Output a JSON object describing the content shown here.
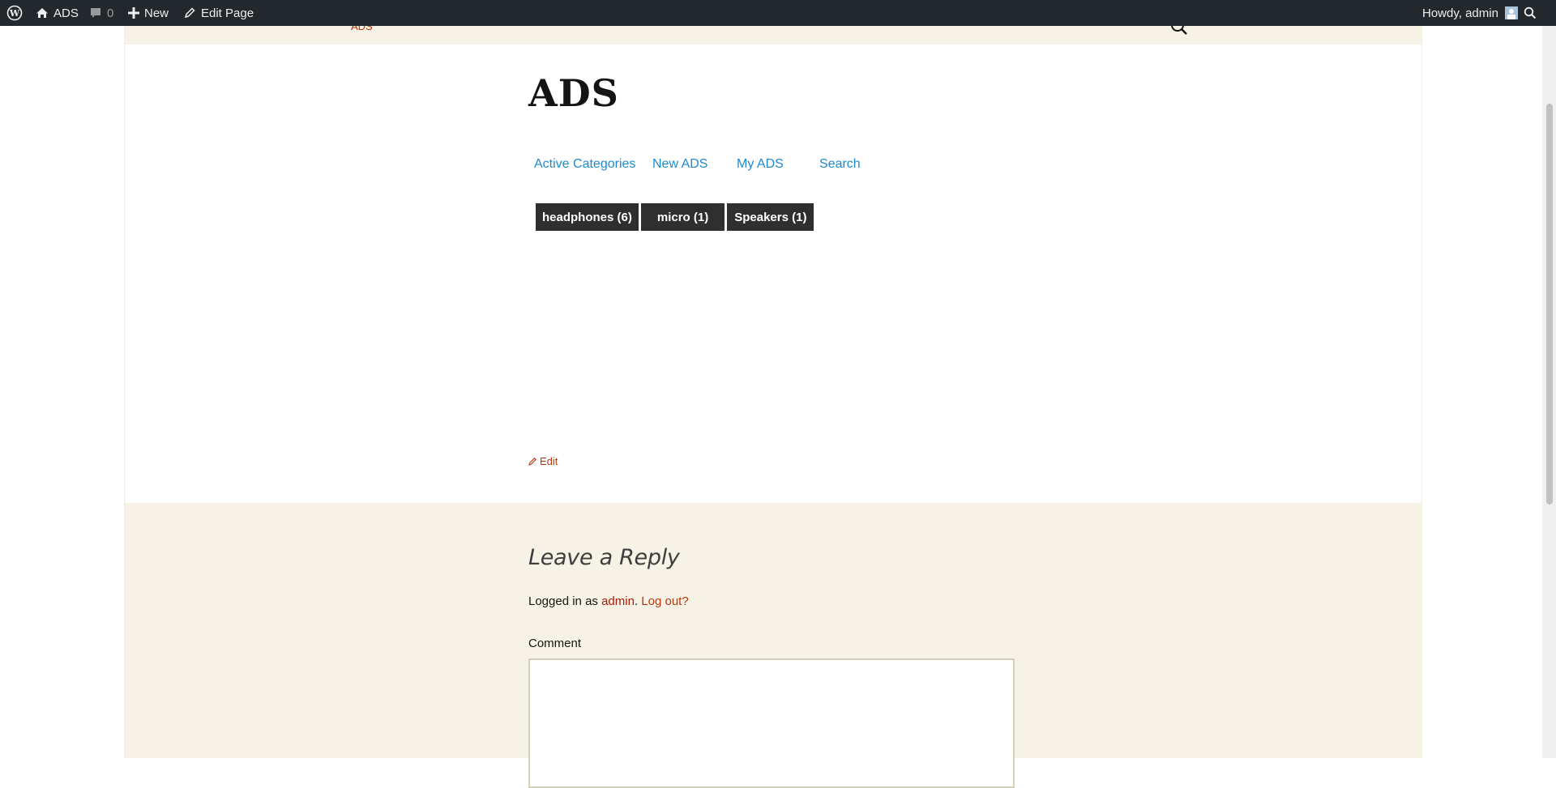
{
  "admin_bar": {
    "site_name": "ADS",
    "comments_count": "0",
    "new_label": "New",
    "edit_page_label": "Edit Page",
    "howdy_text": "Howdy, admin"
  },
  "header": {
    "breadcrumb": "ADS"
  },
  "site": {
    "title": "ADS"
  },
  "menu": {
    "items": [
      "Active Categories",
      "New ADS",
      "My ADS",
      "Search"
    ]
  },
  "categories": [
    {
      "label": "headphones (6)"
    },
    {
      "label": "micro (1)"
    },
    {
      "label": "Speakers (1)"
    }
  ],
  "edit_link": "Edit",
  "comments": {
    "title": "Leave a Reply",
    "logged_in_prefix": "Logged in as ",
    "username": "admin",
    "separator": ". ",
    "logout_label": "Log out?",
    "comment_label": "Comment",
    "comment_value": ""
  },
  "colors": {
    "admin_bar_bg": "#23282d",
    "cream_bg": "#f6f3e6",
    "link_blue": "#1d8ad0",
    "link_red": "#bc360a",
    "category_bg": "#2f2f2f"
  }
}
